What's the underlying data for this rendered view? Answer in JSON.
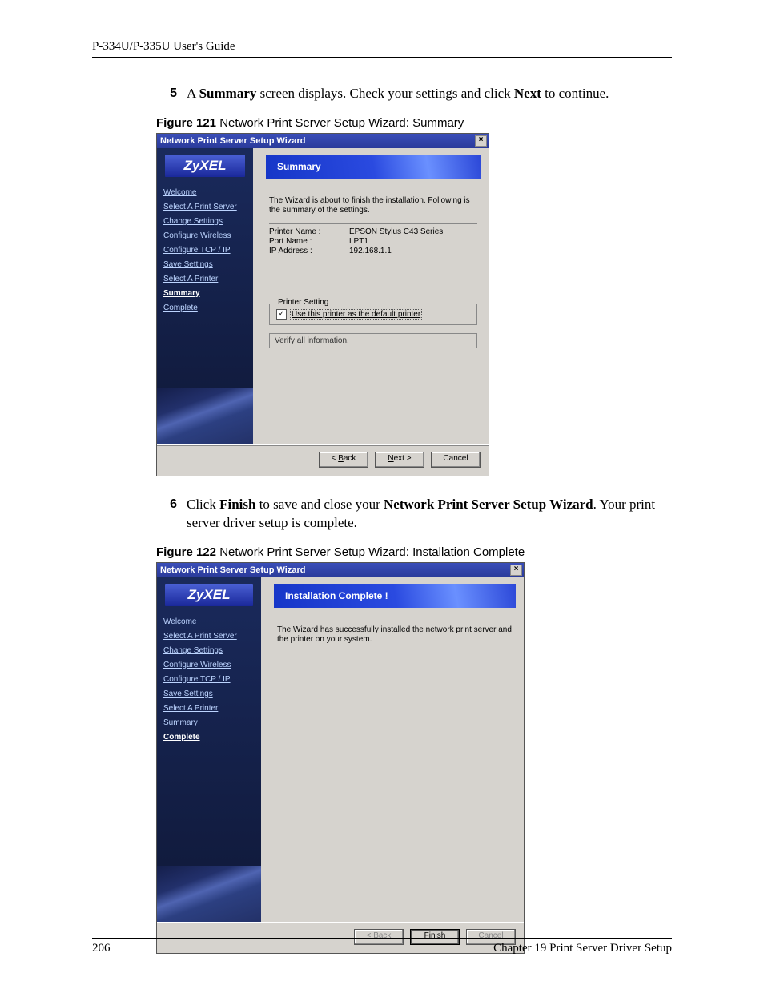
{
  "header": "P-334U/P-335U User's Guide",
  "steps": {
    "s5": {
      "num": "5",
      "t1": "A ",
      "b1": "Summary",
      "t2": " screen displays. Check your settings and click ",
      "b2": "Next",
      "t3": " to continue."
    },
    "s6": {
      "num": "6",
      "t1": "Click ",
      "b1": "Finish",
      "t2": " to save and close your ",
      "b2": "Network Print Server Setup Wizard",
      "t3": ". Your print server driver setup is complete."
    }
  },
  "fig121": {
    "label": "Figure 121",
    "caption": "   Network Print Server Setup Wizard: Summary"
  },
  "fig122": {
    "label": "Figure 122",
    "caption": "   Network Print Server Setup Wizard: Installation Complete"
  },
  "wiz1": {
    "title": "Network Print Server Setup Wizard",
    "logo": "ZyXEL",
    "side": [
      "Welcome",
      "Select A Print Server",
      "Change Settings",
      "Configure Wireless",
      "Configure  TCP / IP",
      "Save Settings",
      "Select A Printer",
      "Summary",
      "Complete"
    ],
    "activeIndex": 7,
    "heading": "Summary",
    "desc": "The Wizard is about to finish the installation. Following is the summary of the settings.",
    "rows": [
      {
        "label": "Printer Name :",
        "value": "EPSON Stylus C43 Series"
      },
      {
        "label": "Port Name :",
        "value": "LPT1"
      },
      {
        "label": "IP Address :",
        "value": "192.168.1.1"
      }
    ],
    "fieldset_legend": "Printer Setting",
    "checkbox_label": "Use this printer as the default printer",
    "verify": "Verify all information.",
    "btn_back_lt": "< ",
    "btn_back_u": "B",
    "btn_back_rest": "ack",
    "btn_next_u": "N",
    "btn_next_rest": "ext >",
    "btn_cancel": "Cancel"
  },
  "wiz2": {
    "title": "Network Print Server Setup Wizard",
    "logo": "ZyXEL",
    "side": [
      "Welcome",
      "Select A Print Server",
      "Change Settings",
      "Configure Wireless",
      "Configure  TCP / IP",
      "Save Settings",
      "Select A Printer",
      "Summary",
      "Complete"
    ],
    "activeIndex": 8,
    "heading": "Installation Complete !",
    "desc": "The Wizard has successfully installed the network print server and the printer on your system.",
    "btn_back_lt": "< ",
    "btn_back_u": "B",
    "btn_back_rest": "ack",
    "btn_finish": "Finish",
    "btn_cancel": "Cancel"
  },
  "footer": {
    "page": "206",
    "chapter": "Chapter 19 Print Server Driver Setup"
  }
}
